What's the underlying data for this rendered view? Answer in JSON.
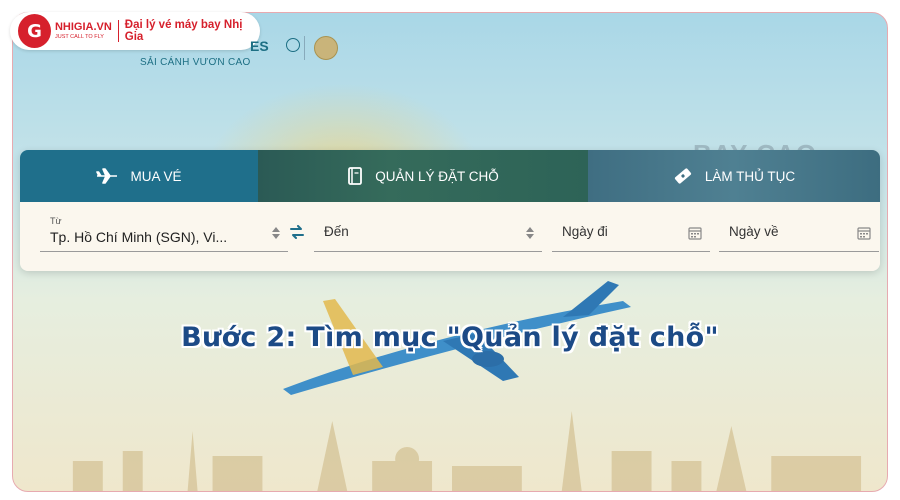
{
  "brand": {
    "logo_letter": "G",
    "logo_name": "NHIGIA.VN",
    "logo_tagline": "JUST CALL TO FLY",
    "description": "Đại lý vé máy bay Nhị Gia"
  },
  "airline": {
    "logo_text": "ES",
    "slogan": "SẢI CÁNH VƯƠN CAO",
    "watermark": "BAY CAO"
  },
  "tabs": [
    {
      "label": "MUA VÉ",
      "icon": "airplane-icon"
    },
    {
      "label": "QUẢN LÝ ĐẶT CHỖ",
      "icon": "book-icon"
    },
    {
      "label": "LÀM THỦ TỤC",
      "icon": "ticket-icon"
    }
  ],
  "form": {
    "from_label": "Từ",
    "from_value": "Tp. Hồ Chí Minh (SGN), Vi...",
    "to_placeholder": "Đến",
    "depart_placeholder": "Ngày đi",
    "return_placeholder": "Ngày về"
  },
  "caption": "Bước 2: Tìm mục \"Quản lý đặt chỗ\"",
  "colors": {
    "brand_red": "#d6202c",
    "tab_active": "#1f6f8b",
    "caption_blue": "#1c4a86"
  }
}
